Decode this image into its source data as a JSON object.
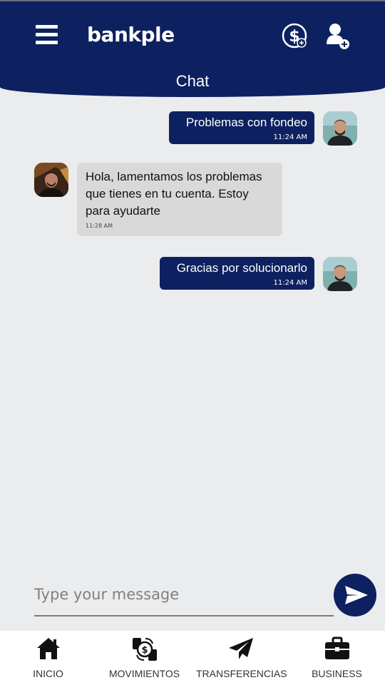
{
  "header": {
    "logo_text": "bankple",
    "title": "Chat",
    "color": "#0d2160"
  },
  "messages": [
    {
      "direction": "outgoing",
      "text": "Problemas con fondeo",
      "time": "11:24 AM"
    },
    {
      "direction": "incoming",
      "text": "Hola, lamentamos los problemas que tienes en tu cuenta. Estoy para ayudarte",
      "time": "11:28 AM"
    },
    {
      "direction": "outgoing",
      "text": "Gracias por solucionarlo",
      "time": "11:24 AM"
    }
  ],
  "composer": {
    "placeholder": "Type your message"
  },
  "nav": [
    {
      "label": "INICIO",
      "icon": "home-icon"
    },
    {
      "label": "MOVIMIENTOS",
      "icon": "money-exchange-icon"
    },
    {
      "label": "TRANSFERENCIAS",
      "icon": "paper-plane-icon"
    },
    {
      "label": "BUSINESS",
      "icon": "briefcase-icon"
    }
  ]
}
